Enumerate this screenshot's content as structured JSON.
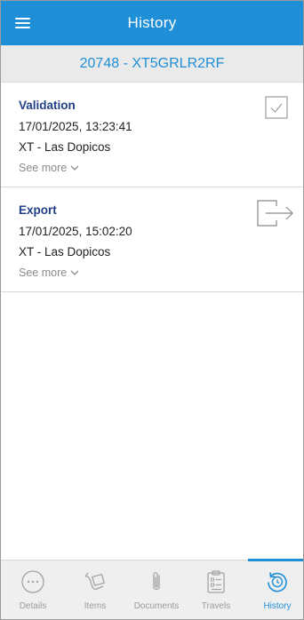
{
  "header": {
    "title": "History",
    "menu_icon": "hamburger-menu-icon"
  },
  "subheader": {
    "reference": "20748 - XT5GRLR2RF"
  },
  "events": [
    {
      "title": "Validation",
      "datetime": "17/01/2025, 13:23:41",
      "location": "XT - Las Dopicos",
      "see_more": "See more",
      "icon": "checkbox-check-icon"
    },
    {
      "title": "Export",
      "datetime": "17/01/2025, 15:02:20",
      "location": "XT - Las Dopicos",
      "see_more": "See more",
      "icon": "export-arrow-icon"
    }
  ],
  "bottom_nav": {
    "items": [
      {
        "label": "Details",
        "icon": "more-dots-icon",
        "active": false
      },
      {
        "label": "Items",
        "icon": "box-hand-icon",
        "active": false
      },
      {
        "label": "Documents",
        "icon": "paperclip-icon",
        "active": false
      },
      {
        "label": "Travels",
        "icon": "clipboard-icon",
        "active": false
      },
      {
        "label": "History",
        "icon": "history-icon",
        "active": true
      }
    ]
  },
  "colors": {
    "primary": "#1e8fd6",
    "title_text": "#1f3f86",
    "muted": "#9a9a9a"
  }
}
